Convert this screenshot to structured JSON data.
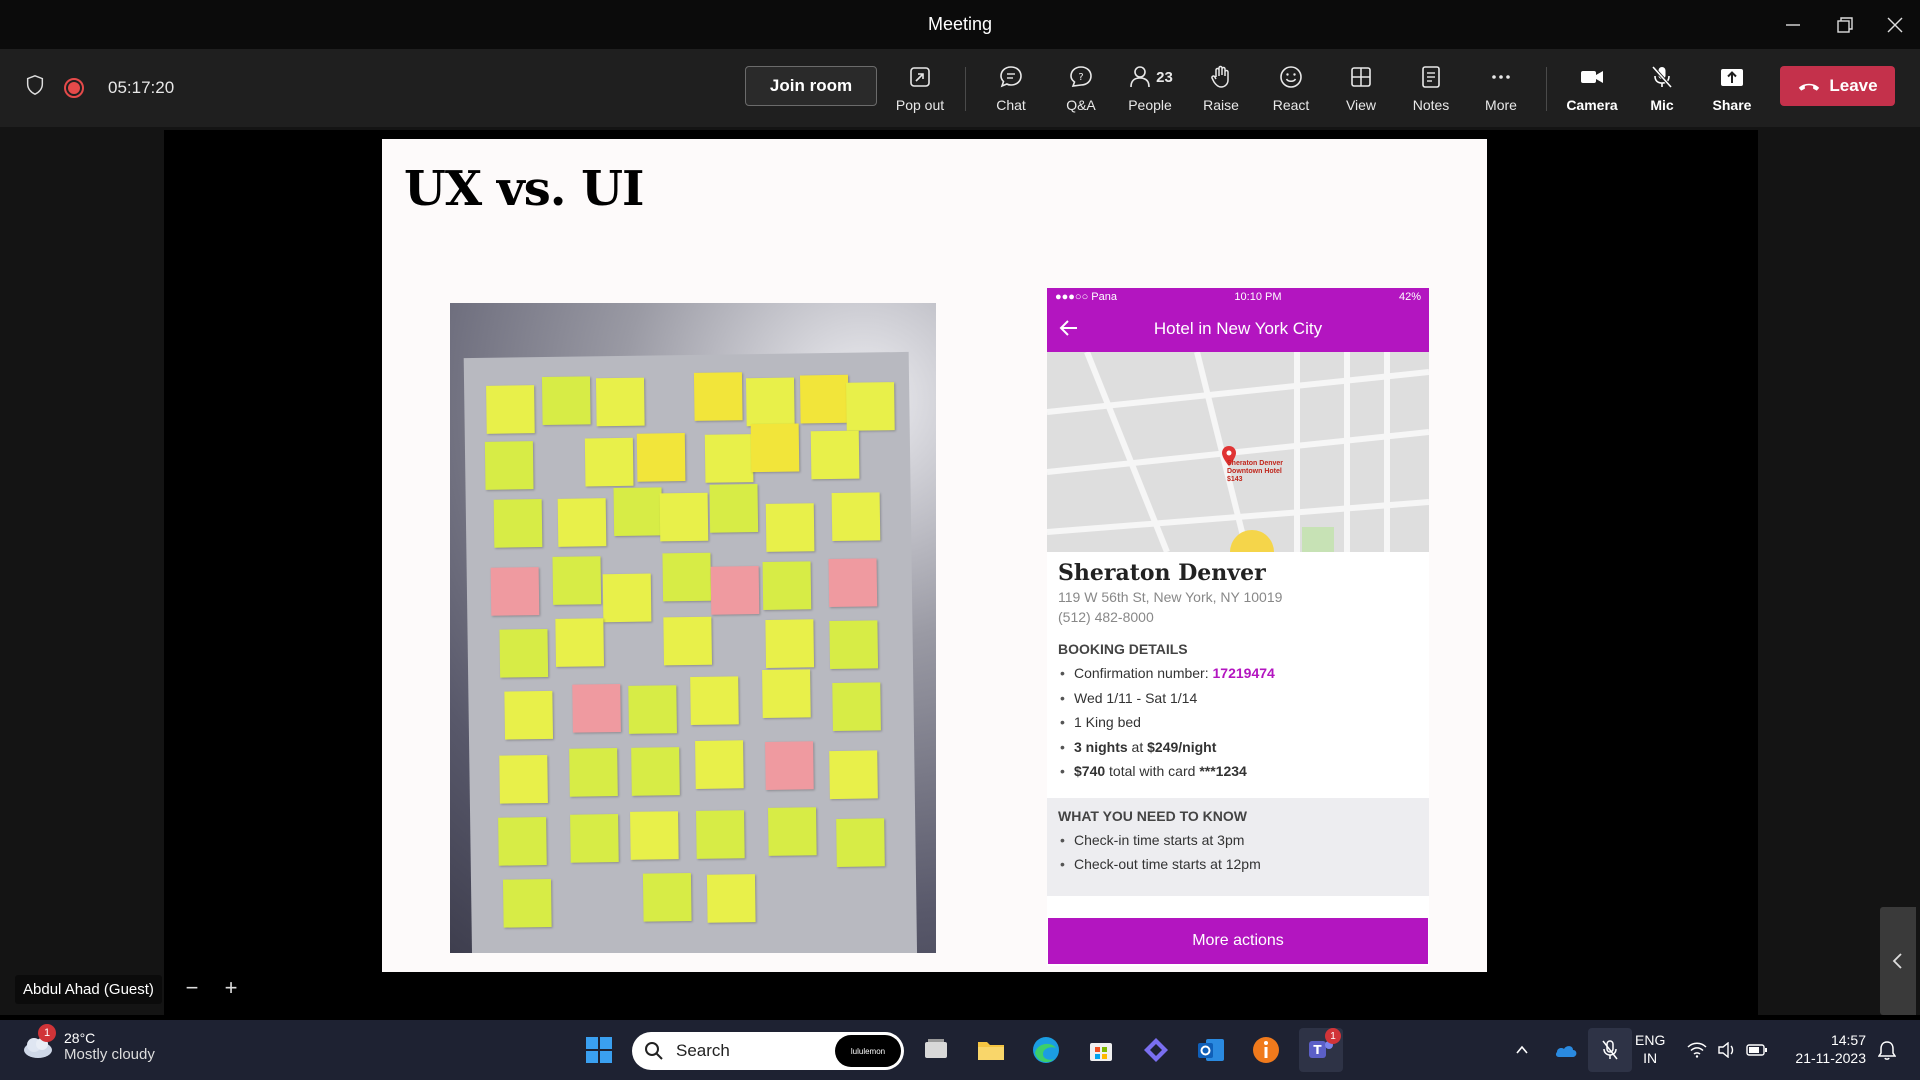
{
  "window": {
    "title": "Meeting"
  },
  "toolbar": {
    "timer": "05:17:20",
    "join_room": "Join room",
    "buttons": {
      "pop_out": "Pop out",
      "chat": "Chat",
      "qa": "Q&A",
      "people": "People",
      "people_count": "23",
      "raise": "Raise",
      "react": "React",
      "view": "View",
      "notes": "Notes",
      "more": "More",
      "camera": "Camera",
      "mic": "Mic",
      "share": "Share"
    },
    "leave": "Leave"
  },
  "slide": {
    "title": "UX vs. UI",
    "phone": {
      "status_carrier": "●●●○○ Pana",
      "status_time": "10:10 PM",
      "status_battery": "42%",
      "header_title": "Hotel in New York City",
      "map_pin_label": "Sheraton Denver Downtown Hotel $143",
      "hotel_name": "Sheraton Denver",
      "address": "119 W 56th St, New York, NY 10019",
      "phone": "(512) 482-8000",
      "booking_heading": "BOOKING DETAILS",
      "confirmation_label": "Confirmation number: ",
      "confirmation_number": "17219474",
      "dates": "Wed 1/11 - Sat 1/14",
      "bed": "1 King bed",
      "nights_bold": "3 nights",
      "nights_at": " at ",
      "nights_rate": "$249/night",
      "total_bold": "$740",
      "total_rest": " total with card ",
      "card": "***1234",
      "need_heading": "WHAT YOU NEED TO KNOW",
      "checkin": "Check-in time starts at 3pm",
      "checkout": "Check-out time starts at 12pm",
      "more_actions": "More actions"
    }
  },
  "participant": {
    "name": "Abdul Ahad (Guest)"
  },
  "taskbar": {
    "weather_badge": "1",
    "temperature": "28°C",
    "condition": "Mostly cloudy",
    "search_placeholder": "Search",
    "search_brand": "lululemon",
    "teams_badge": "1",
    "language_top": "ENG",
    "language_bottom": "IN",
    "time": "14:57",
    "date": "21-11-2023"
  },
  "colors": {
    "accent_purple": "#b315c0",
    "leave_red": "#c4314b",
    "recording_red": "#e54a4a",
    "taskbar_bg": "#1e2232"
  }
}
